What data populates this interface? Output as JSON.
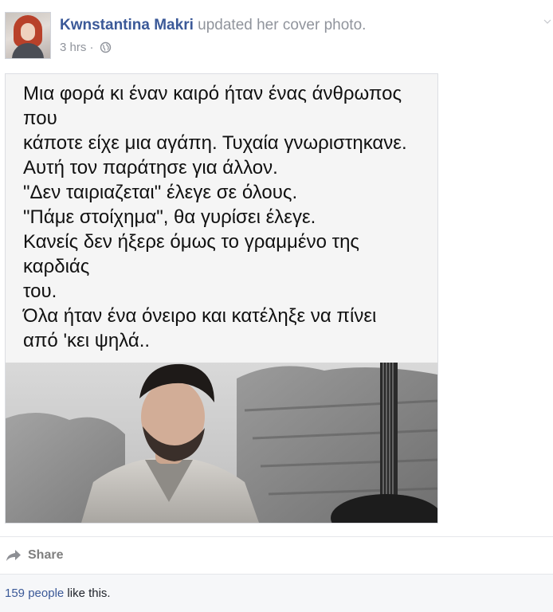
{
  "post": {
    "author_name": "Kwnstantina Makri",
    "action_text": "updated her cover photo.",
    "timestamp": "3 hrs",
    "separator": "·",
    "privacy_icon": "globe-icon"
  },
  "photo": {
    "text_lines": [
      "Μια φορά κι έναν καιρό ήταν ένας άνθρωπος",
      "που",
      "κάποτε είχε μια αγάπη. Τυχαία γνωριστηκανε.",
      "Αυτή τον παράτησε για άλλον.",
      "\"Δεν ταιριαζεται\" έλεγε σε όλους.",
      "\"Πάμε στοίχημα\", θα γυρίσει έλεγε.",
      "Κανείς δεν ήξερε όμως το γραμμένο της",
      "καρδιάς",
      "του.",
      "Όλα ήταν ένα όνειρο και κατέληξε να πίνει",
      "από 'κει ψηλά.."
    ]
  },
  "actions": {
    "share_label": "Share",
    "share_icon": "share-arrow-icon"
  },
  "likes": {
    "count_text": "159 people",
    "suffix": " like this."
  },
  "colors": {
    "link_blue": "#3b5998",
    "meta_gray": "#90949c",
    "likes_background": "#f6f7f9"
  }
}
